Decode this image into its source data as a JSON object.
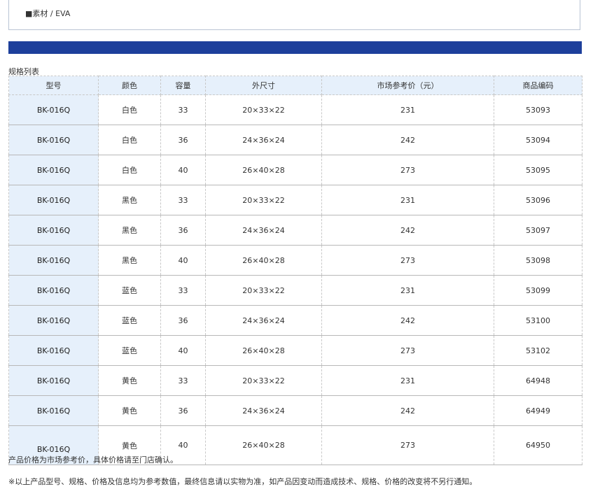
{
  "material": "■素材 / EVA",
  "spec_title": "规格列表",
  "table": {
    "headers": [
      "型号",
      "颜色",
      "容量",
      "外尺寸",
      "市场参考价（元）",
      "商品编码"
    ],
    "rows": [
      [
        "BK-016Q",
        "白色",
        "33",
        "20×33×22",
        "231",
        "53093"
      ],
      [
        "BK-016Q",
        "白色",
        "36",
        "24×36×24",
        "242",
        "53094"
      ],
      [
        "BK-016Q",
        "白色",
        "40",
        "26×40×28",
        "273",
        "53095"
      ],
      [
        "BK-016Q",
        "黑色",
        "33",
        "20×33×22",
        "231",
        "53096"
      ],
      [
        "BK-016Q",
        "黑色",
        "36",
        "24×36×24",
        "242",
        "53097"
      ],
      [
        "BK-016Q",
        "黑色",
        "40",
        "26×40×28",
        "273",
        "53098"
      ],
      [
        "BK-016Q",
        "蓝色",
        "33",
        "20×33×22",
        "231",
        "53099"
      ],
      [
        "BK-016Q",
        "蓝色",
        "36",
        "24×36×24",
        "242",
        "53100"
      ],
      [
        "BK-016Q",
        "蓝色",
        "40",
        "26×40×28",
        "273",
        "53102"
      ],
      [
        "BK-016Q",
        "黄色",
        "33",
        "20×33×22",
        "231",
        "64948"
      ],
      [
        "BK-016Q",
        "黄色",
        "36",
        "24×36×24",
        "242",
        "64949"
      ],
      [
        "BK-016Q",
        "黄色",
        "40",
        "26×40×28",
        "273",
        "64950"
      ]
    ]
  },
  "notes": {
    "price_note": "产品价格为市场参考价，具体价格请至门店确认。",
    "disclaimer": "※以上产品型号、规格、价格及信息均为参考数值，最终信息请以实物为准，如产品因变动而造成技术、规格、价格的改变将不另行通知。"
  },
  "colors": {
    "accent_bar": "#1d3f9b",
    "header_bg": "#e6f0fb"
  }
}
